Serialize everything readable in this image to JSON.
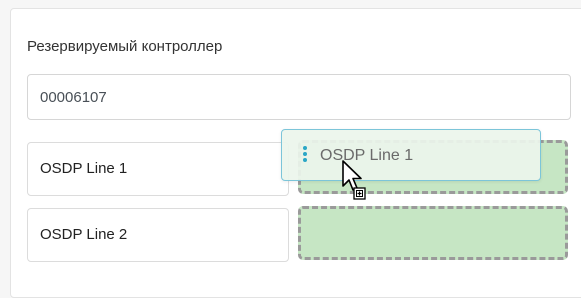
{
  "form": {
    "reserve_controller_label": "Резервируемый контроллер",
    "reserve_controller_value": "00006107"
  },
  "lines": {
    "items": [
      {
        "label": "OSDP Line 1"
      },
      {
        "label": "OSDP Line 2"
      }
    ]
  },
  "drag": {
    "label": "OSDP Line 1",
    "grip_icon": "grip-vertical-icon",
    "cursor_icon": "copy-cursor-icon"
  },
  "colors": {
    "drop_zone_fill": "#c6e6c4",
    "drop_zone_border": "#9a9a9a",
    "drag_border": "#7cc5d9",
    "grip": "#2aa6c6"
  }
}
